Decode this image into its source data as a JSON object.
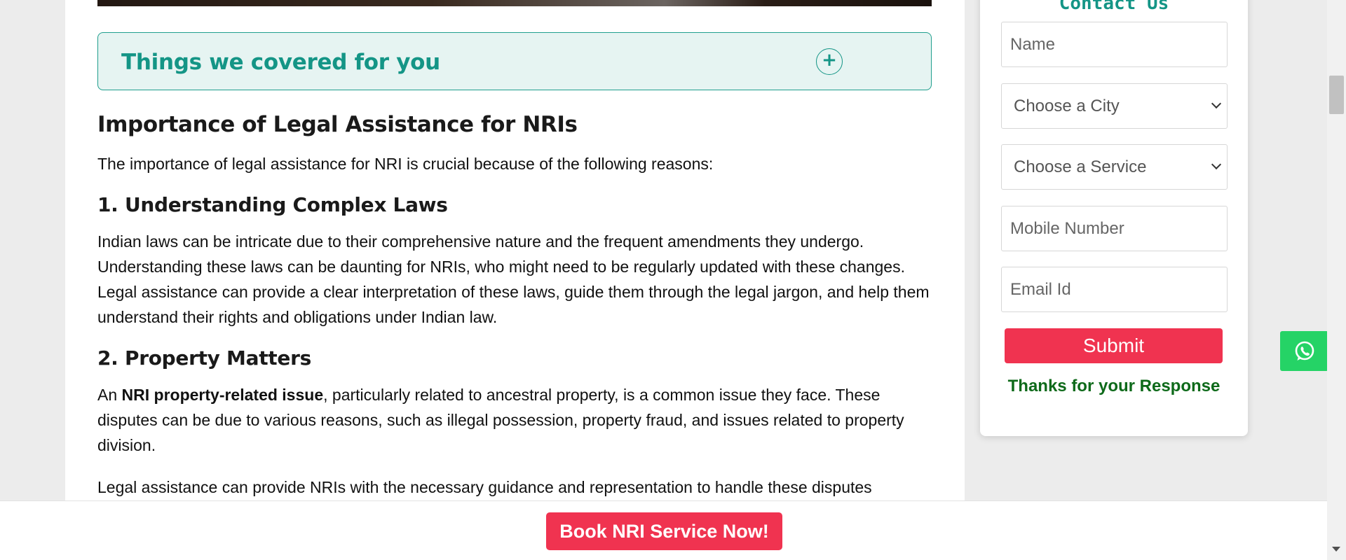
{
  "accordion": {
    "title": "Things we covered for you",
    "toggle": "+"
  },
  "article": {
    "title": "Importance of Legal Assistance for NRIs",
    "intro": "The importance of legal assistance for NRI is crucial because of the following reasons:",
    "section1": {
      "heading": "1. Understanding Complex Laws",
      "body": "Indian laws can be intricate due to their comprehensive nature and the frequent amendments they undergo. Understanding these laws can be daunting for NRIs, who might need to be regularly updated with these changes. Legal assistance can provide a clear interpretation of these laws, guide them through the legal jargon, and help them understand their rights and obligations under Indian law."
    },
    "section2": {
      "heading": "2. Property Matters",
      "body_prefix": "An ",
      "body_bold": "NRI property-related issue",
      "body_rest": ", particularly related to ancestral property, is a common issue they face. These disputes can be due to various reasons, such as illegal possession, property fraud, and issues related to property division.",
      "body2": "Legal assistance can provide NRIs with the necessary guidance and representation to handle these disputes"
    }
  },
  "form": {
    "heading": "Contact Us",
    "name_placeholder": "Name",
    "city_select": "Choose a City",
    "service_select": "Choose a Service",
    "mobile_placeholder": "Mobile Number",
    "email_placeholder": "Email Id",
    "submit_label": "Submit",
    "thanks": "Thanks for your Response"
  },
  "bottom_bar": {
    "cta_label": "Book NRI Service Now!"
  },
  "icons": {
    "whatsapp": "whatsapp-icon",
    "plus": "plus-icon"
  },
  "colors": {
    "accent": "#149586",
    "cta": "#f03350",
    "whatsapp": "#25d366",
    "thanks": "#0e6a1a"
  }
}
